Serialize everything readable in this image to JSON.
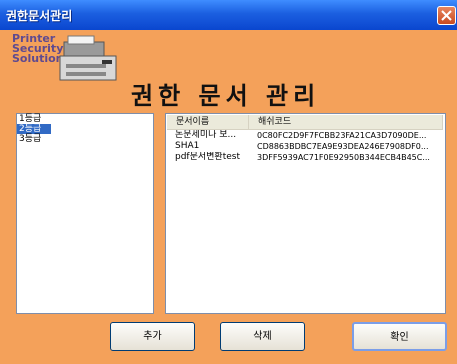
{
  "window": {
    "title": "권한문서관리"
  },
  "banner": {
    "logo_lines": [
      "Printer",
      "Security",
      "Solution"
    ],
    "heading": "권한 문서 관리"
  },
  "grades": [
    {
      "label": "1등급",
      "selected": false
    },
    {
      "label": "2등급",
      "selected": true
    },
    {
      "label": "3등급",
      "selected": false
    }
  ],
  "documents": {
    "columns": [
      "문서이름",
      "해쉬코드"
    ],
    "rows": [
      {
        "name": "논문세미나 보...",
        "hash": "0C80FC2D9F7FCBB23FA21CA3D7090DE..."
      },
      {
        "name": "SHA1",
        "hash": "CD8863BDBC7EA9E93DEA246E7908DF0..."
      },
      {
        "name": "pdf문서변환test",
        "hash": "3DFF5939AC71F0E92950B344ECB4B45C..."
      }
    ]
  },
  "buttons": {
    "add": "추가",
    "delete": "삭제",
    "confirm": "확인"
  },
  "colors": {
    "background": "#f4a15a",
    "titlebar": "#1b5fe0",
    "selection": "#316ac5"
  }
}
